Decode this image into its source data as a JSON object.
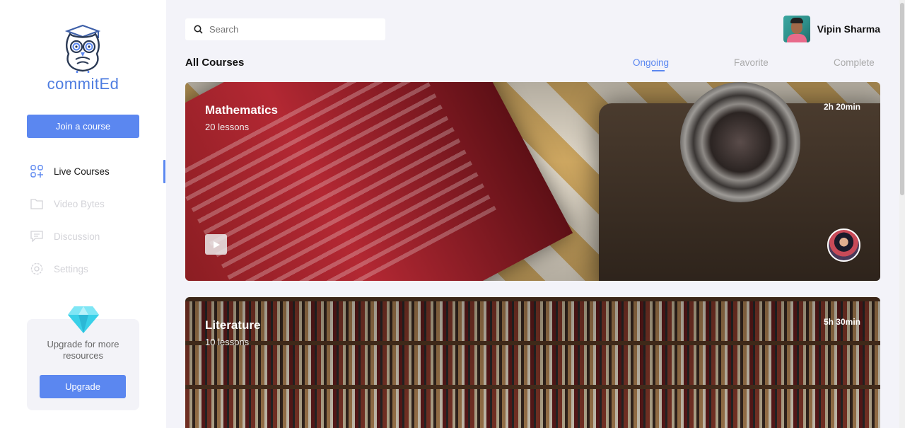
{
  "brand": {
    "name": "commitEd"
  },
  "sidebar": {
    "join_label": "Join a course",
    "items": [
      {
        "label": "Live Courses",
        "icon": "grid-plus-icon",
        "active": true
      },
      {
        "label": "Video Bytes",
        "icon": "folder-icon",
        "active": false
      },
      {
        "label": "Discussion",
        "icon": "chat-icon",
        "active": false
      },
      {
        "label": "Settings",
        "icon": "gear-icon",
        "active": false
      }
    ],
    "upgrade": {
      "text": "Upgrade for more resources",
      "button_label": "Upgrade",
      "icon": "diamond-icon"
    }
  },
  "header": {
    "search": {
      "placeholder": "Search",
      "value": ""
    },
    "user": {
      "name": "Vipin Sharma"
    }
  },
  "courses": {
    "title": "All Courses",
    "tabs": [
      {
        "label": "Ongoing",
        "active": true
      },
      {
        "label": "Favorite",
        "active": false
      },
      {
        "label": "Complete",
        "active": false
      }
    ],
    "cards": [
      {
        "title": "Mathematics",
        "lessons": "20 lessons",
        "duration": "2h 20min"
      },
      {
        "title": "Literature",
        "lessons": "10 lessons",
        "duration": "5h 30min"
      }
    ]
  },
  "colors": {
    "accent": "#5b87f0",
    "brand_text": "#4d7ce0",
    "background": "#f3f3f9"
  }
}
